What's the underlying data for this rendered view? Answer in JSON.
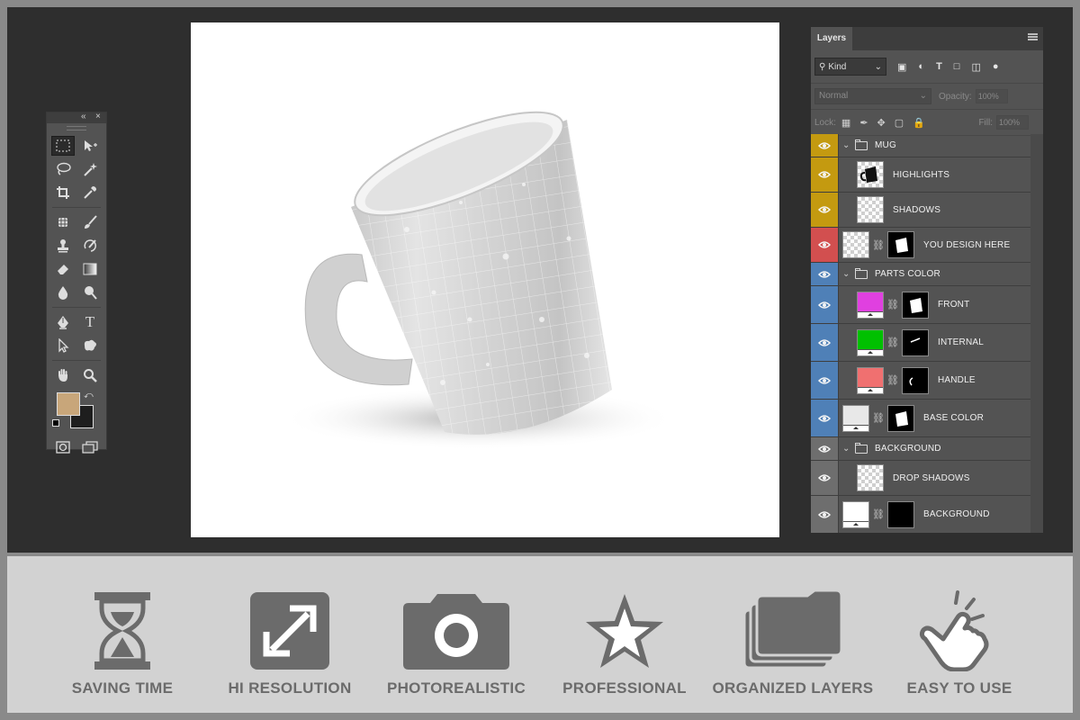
{
  "colors": {
    "outer_frame": "#8a8a8a",
    "workspace": "#2e2e2e",
    "panel": "#535353",
    "foreground_color": "#c8a67a",
    "background_color": "#1e1e1e",
    "group_mug": "#c49a10",
    "layer_design": "#d24f4f",
    "group_parts": "#4f80b7",
    "group_background": "#6e6e6e",
    "feature_gray": "#6b6b6b"
  },
  "toolbox": {
    "header_collapse": "«",
    "header_close": "×",
    "tools": [
      [
        "rectangular-marquee-icon",
        "move-icon"
      ],
      [
        "lasso-icon",
        "magic-wand-icon"
      ],
      [
        "crop-icon",
        "eyedropper-icon"
      ],
      [
        "healing-brush-icon",
        "brush-icon"
      ],
      [
        "clone-stamp-icon",
        "history-brush-icon"
      ],
      [
        "eraser-icon",
        "gradient-icon"
      ],
      [
        "blur-icon",
        "dodge-icon"
      ],
      [
        "pen-icon",
        "type-icon"
      ],
      [
        "path-selection-icon",
        "custom-shape-icon"
      ],
      [
        "hand-icon",
        "zoom-icon"
      ]
    ],
    "type_glyph": "T"
  },
  "layers_panel": {
    "tab_label": "Layers",
    "kind_label": "Kind",
    "blend_mode": "Normal",
    "opacity_label": "Opacity:",
    "opacity_value": "100%",
    "lock_label": "Lock:",
    "fill_label": "Fill:",
    "fill_value": "100%",
    "type_filter_glyph": "T",
    "layers": [
      {
        "name": "MUG",
        "kind": "group",
        "color": "group_mug"
      },
      {
        "name": "HIGHLIGHTS",
        "kind": "layer",
        "color": "group_mug"
      },
      {
        "name": "SHADOWS",
        "kind": "layer",
        "color": "group_mug"
      },
      {
        "name": "YOU DESIGN HERE",
        "kind": "smart",
        "color": "layer_design"
      },
      {
        "name": "PARTS COLOR",
        "kind": "group",
        "color": "group_parts"
      },
      {
        "name": "FRONT",
        "kind": "fill",
        "fill": "#e040e0",
        "color": "group_parts"
      },
      {
        "name": "INTERNAL",
        "kind": "fill",
        "fill": "#00c000",
        "color": "group_parts"
      },
      {
        "name": "HANDLE",
        "kind": "fill",
        "fill": "#f07070",
        "color": "group_parts"
      },
      {
        "name": "BASE COLOR",
        "kind": "fill",
        "fill": "#e8e8e8",
        "color": "group_parts"
      },
      {
        "name": "BACKGROUND",
        "kind": "group",
        "color": "group_background"
      },
      {
        "name": "DROP SHADOWS",
        "kind": "layer",
        "color": "group_background"
      },
      {
        "name": "BACKGROUND",
        "kind": "fill",
        "fill": "#ffffff",
        "color": "group_background"
      }
    ]
  },
  "features": [
    {
      "label": "SAVING TIME",
      "icon": "hourglass-icon"
    },
    {
      "label": "HI RESOLUTION",
      "icon": "expand-arrows-icon"
    },
    {
      "label": "PHOTOREALISTIC",
      "icon": "camera-icon"
    },
    {
      "label": "PROFESSIONAL",
      "icon": "star-icon"
    },
    {
      "label": "ORGANIZED LAYERS",
      "icon": "layers-folder-icon"
    },
    {
      "label": "EASY TO USE",
      "icon": "pointing-hand-icon"
    }
  ]
}
